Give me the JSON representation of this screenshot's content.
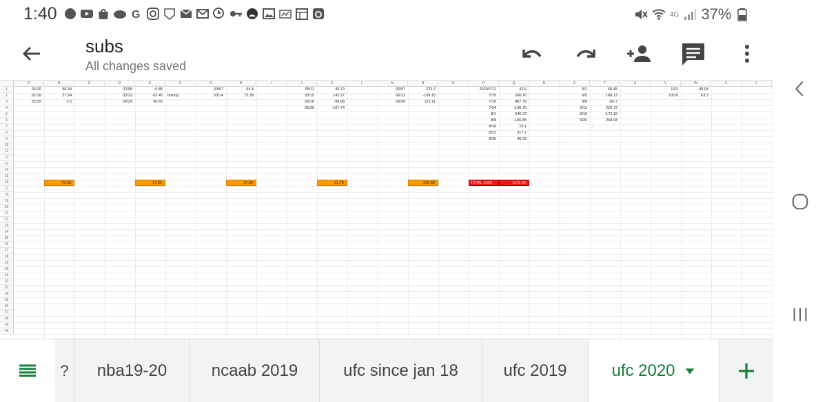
{
  "status_bar": {
    "time": "1:40",
    "battery": "37%",
    "network": "4G",
    "notification_icons": [
      "signal-messenger-icon",
      "youtube-icon",
      "shopping-bag-icon",
      "cloud-icon",
      "google-icon",
      "instagram-icon",
      "nfl-icon",
      "email-icon",
      "gmail-icon",
      "clock-icon",
      "key-icon",
      "dark-circle-icon",
      "gallery-icon",
      "image-icon",
      "calendar-icon",
      "timer-icon"
    ]
  },
  "app_bar": {
    "title": "subs",
    "subtitle": "All changes saved"
  },
  "grid": {
    "columns": [
      "A",
      "B",
      "C",
      "D",
      "E",
      "F",
      "G",
      "H",
      "I",
      "J",
      "K",
      "L",
      "M",
      "N",
      "O",
      "P",
      "Q",
      "R",
      "S",
      "T",
      "U",
      "V",
      "W",
      "X",
      "Y"
    ],
    "rows": [
      "1",
      "2",
      "3",
      "4",
      "5",
      "6",
      "7",
      "8",
      "9",
      "10",
      "11",
      "12",
      "13",
      "14",
      "15",
      "16",
      "17",
      "18",
      "19",
      "20",
      "21",
      "22",
      "23",
      "24",
      "25",
      "26",
      "27",
      "28",
      "29",
      "30",
      "31",
      "32",
      "33",
      "34",
      "35",
      "36",
      "37",
      "38",
      "39",
      "40"
    ],
    "cells": [
      {
        "col": 0,
        "row": 0,
        "text": "01/20",
        "align": "r"
      },
      {
        "col": 1,
        "row": 0,
        "text": "48.34",
        "align": "r"
      },
      {
        "col": 0,
        "row": 1,
        "text": "01/18",
        "align": "r"
      },
      {
        "col": 1,
        "row": 1,
        "text": "27.54",
        "align": "r"
      },
      {
        "col": 0,
        "row": 2,
        "text": "01/25",
        "align": "r"
      },
      {
        "col": 1,
        "row": 2,
        "text": "3.5",
        "align": "r"
      },
      {
        "col": 3,
        "row": 0,
        "text": "02/08",
        "align": "r"
      },
      {
        "col": 4,
        "row": 0,
        "text": "-5.86",
        "align": "r"
      },
      {
        "col": 3,
        "row": 1,
        "text": "02/22",
        "align": "r"
      },
      {
        "col": 4,
        "row": 1,
        "text": "-62.45",
        "align": "r"
      },
      {
        "col": 5,
        "row": 1,
        "text": "boxing",
        "align": "l"
      },
      {
        "col": 3,
        "row": 2,
        "text": "02/29",
        "align": "r"
      },
      {
        "col": 4,
        "row": 2,
        "text": "50.65",
        "align": "r"
      },
      {
        "col": 6,
        "row": 0,
        "text": "03/07",
        "align": "r"
      },
      {
        "col": 7,
        "row": 0,
        "text": "-34.4",
        "align": "r"
      },
      {
        "col": 6,
        "row": 1,
        "text": "03/14",
        "align": "r"
      },
      {
        "col": 7,
        "row": 1,
        "text": "72.38",
        "align": "r"
      },
      {
        "col": 9,
        "row": 0,
        "text": "05/11",
        "align": "r"
      },
      {
        "col": 10,
        "row": 0,
        "text": "43.79",
        "align": "r"
      },
      {
        "col": 9,
        "row": 1,
        "text": "05/15",
        "align": "r"
      },
      {
        "col": 10,
        "row": 1,
        "text": "142.17",
        "align": "r"
      },
      {
        "col": 9,
        "row": 2,
        "text": "05/16",
        "align": "r"
      },
      {
        "col": 10,
        "row": 2,
        "text": "-99.98",
        "align": "r"
      },
      {
        "col": 9,
        "row": 3,
        "text": "05/30",
        "align": "r"
      },
      {
        "col": 10,
        "row": 3,
        "text": "-107.74",
        "align": "r"
      },
      {
        "col": 12,
        "row": 0,
        "text": "06/07",
        "align": "r"
      },
      {
        "col": 13,
        "row": 0,
        "text": "223.7",
        "align": "r"
      },
      {
        "col": 12,
        "row": 1,
        "text": "06/13",
        "align": "r"
      },
      {
        "col": 13,
        "row": 1,
        "text": "-109.15",
        "align": "r"
      },
      {
        "col": 12,
        "row": 2,
        "text": "06/20",
        "align": "r"
      },
      {
        "col": 13,
        "row": 2,
        "text": "122.11",
        "align": "r"
      },
      {
        "col": 15,
        "row": 0,
        "text": "2020/7/12",
        "align": "r"
      },
      {
        "col": 16,
        "row": 0,
        "text": "42.6",
        "align": "r"
      },
      {
        "col": 15,
        "row": 1,
        "text": "7/15",
        "align": "r"
      },
      {
        "col": 16,
        "row": 1,
        "text": "266.76",
        "align": "r"
      },
      {
        "col": 15,
        "row": 2,
        "text": "7/18",
        "align": "r"
      },
      {
        "col": 16,
        "row": 2,
        "text": "407.79",
        "align": "r"
      },
      {
        "col": 15,
        "row": 3,
        "text": "7/24",
        "align": "r"
      },
      {
        "col": 16,
        "row": 3,
        "text": "-136.75",
        "align": "r"
      },
      {
        "col": 15,
        "row": 4,
        "text": "8/1",
        "align": "r"
      },
      {
        "col": 16,
        "row": 4,
        "text": "546.27",
        "align": "r"
      },
      {
        "col": 15,
        "row": 5,
        "text": "8/8",
        "align": "r"
      },
      {
        "col": 16,
        "row": 5,
        "text": "-106.85",
        "align": "r"
      },
      {
        "col": 15,
        "row": 6,
        "text": "8/16",
        "align": "r"
      },
      {
        "col": 16,
        "row": 6,
        "text": "10.1",
        "align": "r"
      },
      {
        "col": 15,
        "row": 7,
        "text": "8/23",
        "align": "r"
      },
      {
        "col": 16,
        "row": 7,
        "text": "317.2",
        "align": "r"
      },
      {
        "col": 15,
        "row": 8,
        "text": "8/30",
        "align": "r"
      },
      {
        "col": 16,
        "row": 8,
        "text": "46.92",
        "align": "r"
      },
      {
        "col": 18,
        "row": 0,
        "text": "9/1",
        "align": "r"
      },
      {
        "col": 19,
        "row": 0,
        "text": "60.45",
        "align": "r"
      },
      {
        "col": 18,
        "row": 1,
        "text": "9/5",
        "align": "r"
      },
      {
        "col": 19,
        "row": 1,
        "text": "168.13",
        "align": "r"
      },
      {
        "col": 18,
        "row": 2,
        "text": "9/8",
        "align": "r"
      },
      {
        "col": 19,
        "row": 2,
        "text": "-60.7",
        "align": "r"
      },
      {
        "col": 18,
        "row": 3,
        "text": "9/12",
        "align": "r"
      },
      {
        "col": 19,
        "row": 3,
        "text": "220.72",
        "align": "r"
      },
      {
        "col": 18,
        "row": 4,
        "text": "9/19",
        "align": "r"
      },
      {
        "col": 19,
        "row": 4,
        "text": "-172.19",
        "align": "r"
      },
      {
        "col": 18,
        "row": 5,
        "text": "9/26",
        "align": "r"
      },
      {
        "col": 19,
        "row": 5,
        "text": "268.94",
        "align": "r"
      },
      {
        "col": 19,
        "row": 6,
        "text": "-",
        "align": "l"
      },
      {
        "col": 21,
        "row": 0,
        "text": "10/3",
        "align": "r"
      },
      {
        "col": 22,
        "row": 0,
        "text": "-49.04",
        "align": "r"
      },
      {
        "col": 21,
        "row": 1,
        "text": "10/10",
        "align": "r"
      },
      {
        "col": 22,
        "row": 1,
        "text": "63.3",
        "align": "r"
      }
    ],
    "highlight_cells": [
      {
        "col": 1,
        "row": 15,
        "text": "79.38",
        "color": "orange"
      },
      {
        "col": 4,
        "row": 15,
        "text": "-17.66",
        "color": "orange"
      },
      {
        "col": 7,
        "row": 15,
        "text": "37.98",
        "color": "orange"
      },
      {
        "col": 10,
        "row": 15,
        "text": "-21.76",
        "color": "orange"
      },
      {
        "col": 13,
        "row": 15,
        "text": "236.66",
        "color": "orange"
      },
      {
        "col": 15,
        "row": 15,
        "text": "TOTAL 2020",
        "color": "red"
      },
      {
        "col": 16,
        "row": 15,
        "text": "1575.45",
        "color": "red"
      }
    ]
  },
  "sheet_tabs": {
    "partial_tab": "?",
    "tabs": [
      "nba19-20",
      "ncaab 2019",
      "ufc since jan 18",
      "ufc 2019",
      "ufc 2020"
    ],
    "active_index": 4
  },
  "colors": {
    "accent": "#188038",
    "highlight_orange": "#ff9900",
    "highlight_red": "#e8171a"
  }
}
